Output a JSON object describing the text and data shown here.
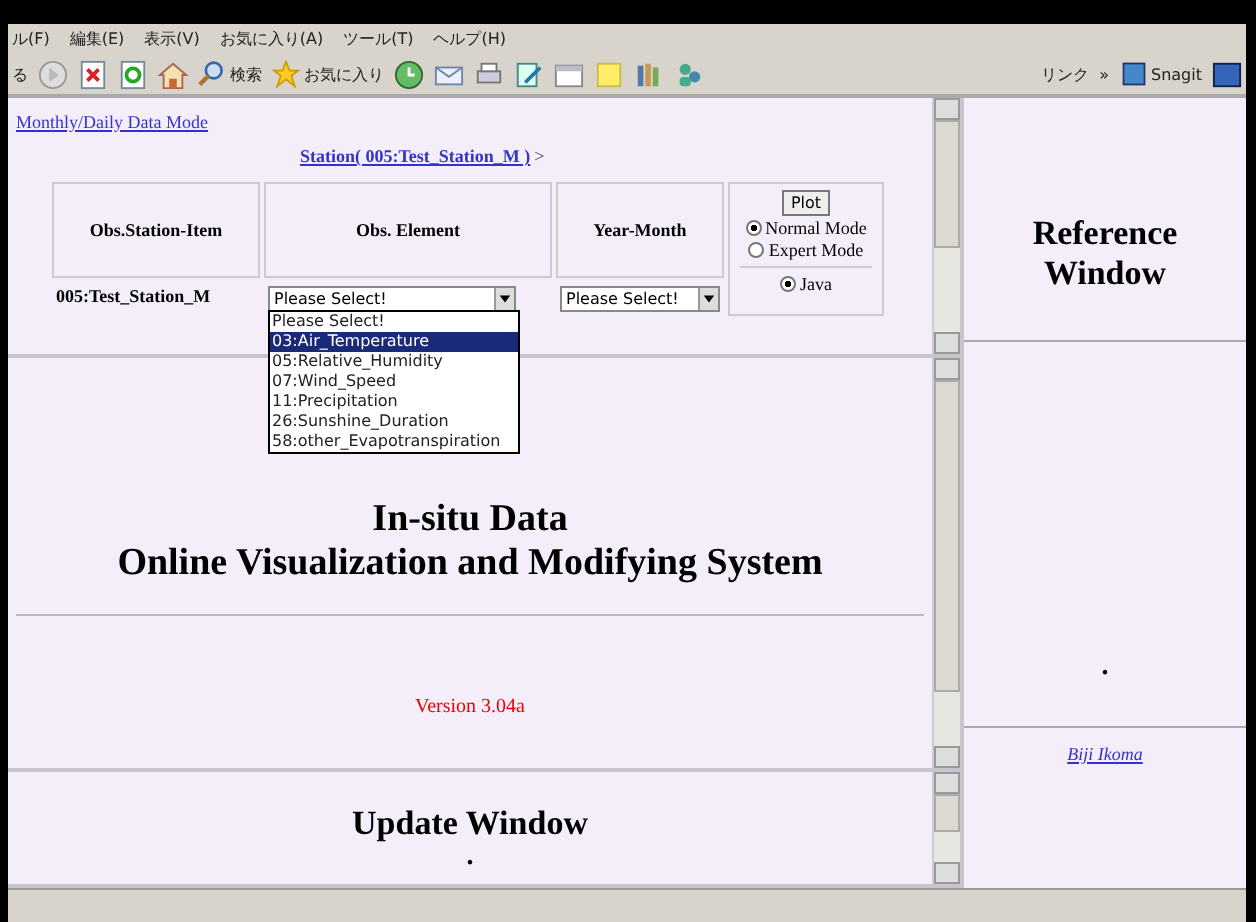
{
  "menu": [
    "ル(F)",
    "編集(E)",
    "表示(V)",
    "お気に入り(A)",
    "ツール(T)",
    "ヘルプ(H)"
  ],
  "toolbar": {
    "back_label": "る",
    "search_label": "検索",
    "favorites_label": "お気に入り",
    "links_label": "リンク",
    "chevron": "»",
    "snagit_label": "Snagit"
  },
  "top_frame": {
    "mode_link": "Monthly/Daily Data Mode",
    "station_link": "Station( 005:Test_Station_M )",
    "station_suffix": ">",
    "columns": [
      "Obs.Station-Item",
      "Obs. Element",
      "Year-Month"
    ],
    "station": "005:Test_Station_M",
    "element_value": "Please Select!",
    "year_month_value": "Please Select!",
    "plot_button": "Plot",
    "modes": [
      {
        "label": "Normal Mode",
        "selected": true
      },
      {
        "label": "Expert Mode",
        "selected": false
      }
    ],
    "viewers": [
      {
        "label": "Java",
        "selected": true
      }
    ]
  },
  "dropdown": {
    "options": [
      {
        "label": "Please Select!",
        "selected": false
      },
      {
        "label": "03:Air_Temperature",
        "selected": true
      },
      {
        "label": "05:Relative_Humidity",
        "selected": false
      },
      {
        "label": "07:Wind_Speed",
        "selected": false
      },
      {
        "label": "11:Precipitation",
        "selected": false
      },
      {
        "label": "26:Sunshine_Duration",
        "selected": false
      },
      {
        "label": "58:other_Evapotranspiration",
        "selected": false
      }
    ]
  },
  "middle_frame": {
    "title_lines": [
      "In-situ Data",
      "Online Visualization and Modifying System"
    ],
    "version": "Version 3.04a"
  },
  "bottom_frame": {
    "title": "Update Window",
    "mark": "."
  },
  "right_frame": {
    "title_lines": [
      "Reference",
      "Window"
    ],
    "mark": ".",
    "author_link": "Biji Ikoma"
  }
}
